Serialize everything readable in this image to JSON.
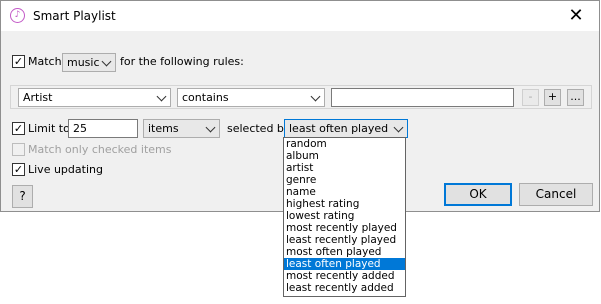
{
  "window": {
    "title": "Smart Playlist",
    "app_icon_glyph": "♪",
    "close_glyph": "✕"
  },
  "match": {
    "checked": true,
    "label": "Match",
    "scope_value": "music",
    "suffix": "for the following rules:"
  },
  "rule": {
    "field_value": "Artist",
    "operator_value": "contains",
    "text_value": "",
    "remove_label": "-",
    "add_label": "+",
    "more_label": "..."
  },
  "limit": {
    "checked": true,
    "label": "Limit to",
    "amount": "25",
    "unit_value": "items",
    "selected_by_label": "selected by",
    "selected_by_value": "least often played"
  },
  "match_checked_only": {
    "checked": false,
    "label": "Match only checked items"
  },
  "live_updating": {
    "checked": true,
    "label": "Live updating"
  },
  "buttons": {
    "help": "?",
    "ok": "OK",
    "cancel": "Cancel"
  },
  "dropdown": {
    "options": [
      "random",
      "album",
      "artist",
      "genre",
      "name",
      "highest rating",
      "lowest rating",
      "most recently played",
      "least recently played",
      "most often played",
      "least often played",
      "most recently added",
      "least recently added"
    ],
    "selected_index": 10
  },
  "colors": {
    "dialog_bg": "#f0f0f0",
    "accent": "#0078d7"
  }
}
